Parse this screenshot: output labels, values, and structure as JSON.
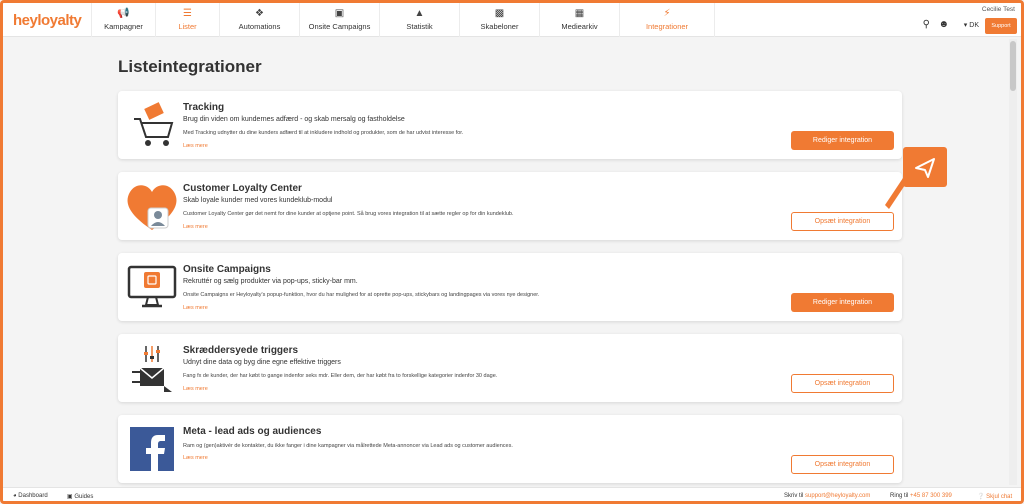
{
  "brand": {
    "logo": "heyloyalty",
    "accent": "#f07a33"
  },
  "nav": {
    "items": [
      {
        "label": "Kampagner",
        "icon": "megaphone-icon",
        "active": false
      },
      {
        "label": "Lister",
        "icon": "list-icon",
        "active": true
      },
      {
        "label": "Automations",
        "icon": "automations-icon",
        "active": false
      },
      {
        "label": "Onsite Campaigns",
        "icon": "onsite-icon",
        "active": false
      },
      {
        "label": "Statistik",
        "icon": "statistics-icon",
        "active": false
      },
      {
        "label": "Skabeloner",
        "icon": "templates-icon",
        "active": false
      },
      {
        "label": "Mediearkiv",
        "icon": "media-icon",
        "active": false
      },
      {
        "label": "Integrationer",
        "icon": "integrations-icon",
        "active": true
      }
    ],
    "user_name": "Cecilie Test",
    "language": "DK",
    "support_label": "Support"
  },
  "page": {
    "title": "Listeintegrationer"
  },
  "cards": [
    {
      "title": "Tracking",
      "subtitle": "Brug din viden om kundernes adfærd - og skab mersalg og fastholdelse",
      "description": "Med Tracking udnytter du dine kunders adfærd til at inkludere indhold og produkter, som de har udvist interesse for.",
      "more": "Læs mere",
      "button": "Rediger integration",
      "button_style": "filled"
    },
    {
      "title": "Customer Loyalty Center",
      "subtitle": "Skab loyale kunder med vores kundeklub-modul",
      "description": "Customer Loyalty Center gør det nemt for dine kunder at optjene point. Så brug vores integration til at sætte regler op for din kundeklub.",
      "more": "Læs mere",
      "button": "Opsæt integration",
      "button_style": "outline"
    },
    {
      "title": "Onsite Campaigns",
      "subtitle": "Rekruttér og sælg produkter via pop-ups, sticky-bar mm.",
      "description": "Onsite Campaigns er Heyloyalty's popup-funktion, hvor du har mulighed for at oprette pop-ups, stickybars og landingpages via vores nye designer.",
      "more": "Læs mere",
      "button": "Rediger integration",
      "button_style": "filled"
    },
    {
      "title": "Skræddersyede triggers",
      "subtitle": "Udnyt dine data og byg dine egne effektive triggers",
      "description": "Fang fx de kunder, der har købt to gange indenfor seks mdr. Eller dem, der har købt fra to forskellige kategorier indenfor 30 dage.",
      "more": "Læs mere",
      "button": "Opsæt integration",
      "button_style": "outline"
    },
    {
      "title": "Meta - lead ads og audiences",
      "subtitle": "",
      "description": "Ram og (gen)aktivér de kontakter, du ikke fanger i dine kampagner via målrettede Meta-annoncer via Lead ads og customer audiences.",
      "more": "Læs mere",
      "button": "Opsæt integration",
      "button_style": "outline"
    }
  ],
  "footer": {
    "dashboard": "Dashboard",
    "guides": "Guides",
    "mail_prefix": "Skriv til",
    "mail": "support@heyloyalty.com",
    "phone_prefix": "Ring til",
    "phone": "+45 87 300 399",
    "chat": "Skjul chat"
  }
}
